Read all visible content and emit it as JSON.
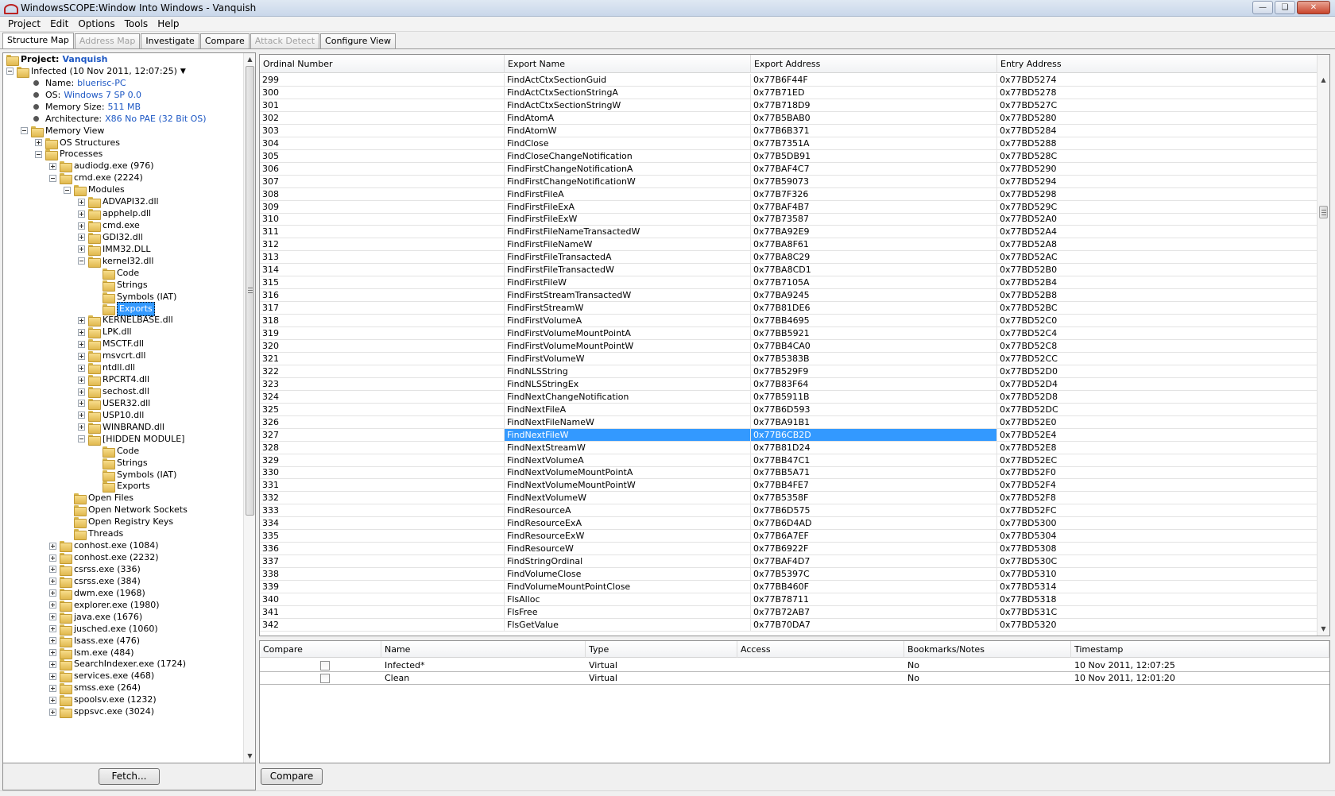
{
  "window": {
    "title": "WindowsSCOPE:Window Into Windows - Vanquish"
  },
  "menu": [
    "Project",
    "Edit",
    "Options",
    "Tools",
    "Help"
  ],
  "tabs": [
    {
      "label": "Structure Map",
      "state": "active"
    },
    {
      "label": "Address Map",
      "state": "disabled"
    },
    {
      "label": "Investigate",
      "state": "normal"
    },
    {
      "label": "Compare",
      "state": "normal"
    },
    {
      "label": "Attack Detect",
      "state": "disabled"
    },
    {
      "label": "Configure View",
      "state": "normal"
    }
  ],
  "tree": [
    {
      "label": "Project:",
      "value": "Vanquish",
      "level": 0,
      "kind": "folder",
      "bold": true
    },
    {
      "label": "Infected (10 Nov 2011, 12:07:25)",
      "level": 0,
      "kind": "folder",
      "exp": "minus",
      "dropdown": true
    },
    {
      "label": "Name:",
      "value": "bluerisc-PC",
      "level": 1,
      "kind": "bullet"
    },
    {
      "label": "OS:",
      "value": "Windows 7 SP 0.0",
      "level": 1,
      "kind": "bullet"
    },
    {
      "label": "Memory Size:",
      "value": "511 MB",
      "level": 1,
      "kind": "bullet"
    },
    {
      "label": "Architecture:",
      "value": "X86 No PAE (32 Bit OS)",
      "level": 1,
      "kind": "bullet"
    },
    {
      "label": "Memory View",
      "level": 1,
      "kind": "folder",
      "exp": "minus"
    },
    {
      "label": "OS Structures",
      "level": 2,
      "kind": "folder",
      "exp": "plus"
    },
    {
      "label": "Processes",
      "level": 2,
      "kind": "folder",
      "exp": "minus"
    },
    {
      "label": "audiodg.exe (976)",
      "level": 3,
      "kind": "folder",
      "exp": "plus"
    },
    {
      "label": "cmd.exe (2224)",
      "level": 3,
      "kind": "folder",
      "exp": "minus"
    },
    {
      "label": "Modules",
      "level": 4,
      "kind": "folder",
      "exp": "minus"
    },
    {
      "label": "ADVAPI32.dll",
      "level": 5,
      "kind": "folder",
      "exp": "plus"
    },
    {
      "label": "apphelp.dll",
      "level": 5,
      "kind": "folder",
      "exp": "plus"
    },
    {
      "label": "cmd.exe",
      "level": 5,
      "kind": "folder",
      "exp": "plus"
    },
    {
      "label": "GDI32.dll",
      "level": 5,
      "kind": "folder",
      "exp": "plus"
    },
    {
      "label": "IMM32.DLL",
      "level": 5,
      "kind": "folder",
      "exp": "plus"
    },
    {
      "label": "kernel32.dll",
      "level": 5,
      "kind": "folder",
      "exp": "minus"
    },
    {
      "label": "Code",
      "level": 6,
      "kind": "folder"
    },
    {
      "label": "Strings",
      "level": 6,
      "kind": "folder"
    },
    {
      "label": "Symbols (IAT)",
      "level": 6,
      "kind": "folder"
    },
    {
      "label": "Exports",
      "level": 6,
      "kind": "folder",
      "selected": true
    },
    {
      "label": "KERNELBASE.dll",
      "level": 5,
      "kind": "folder",
      "exp": "plus"
    },
    {
      "label": "LPK.dll",
      "level": 5,
      "kind": "folder",
      "exp": "plus"
    },
    {
      "label": "MSCTF.dll",
      "level": 5,
      "kind": "folder",
      "exp": "plus"
    },
    {
      "label": "msvcrt.dll",
      "level": 5,
      "kind": "folder",
      "exp": "plus"
    },
    {
      "label": "ntdll.dll",
      "level": 5,
      "kind": "folder",
      "exp": "plus"
    },
    {
      "label": "RPCRT4.dll",
      "level": 5,
      "kind": "folder",
      "exp": "plus"
    },
    {
      "label": "sechost.dll",
      "level": 5,
      "kind": "folder",
      "exp": "plus"
    },
    {
      "label": "USER32.dll",
      "level": 5,
      "kind": "folder",
      "exp": "plus"
    },
    {
      "label": "USP10.dll",
      "level": 5,
      "kind": "folder",
      "exp": "plus"
    },
    {
      "label": "WINBRAND.dll",
      "level": 5,
      "kind": "folder",
      "exp": "plus"
    },
    {
      "label": "[HIDDEN MODULE]",
      "level": 5,
      "kind": "folder",
      "exp": "minus"
    },
    {
      "label": "Code",
      "level": 6,
      "kind": "folder"
    },
    {
      "label": "Strings",
      "level": 6,
      "kind": "folder"
    },
    {
      "label": "Symbols (IAT)",
      "level": 6,
      "kind": "folder"
    },
    {
      "label": "Exports",
      "level": 6,
      "kind": "folder"
    },
    {
      "label": "Open Files",
      "level": 4,
      "kind": "folder"
    },
    {
      "label": "Open Network Sockets",
      "level": 4,
      "kind": "folder"
    },
    {
      "label": "Open Registry Keys",
      "level": 4,
      "kind": "folder"
    },
    {
      "label": "Threads",
      "level": 4,
      "kind": "folder"
    },
    {
      "label": "conhost.exe (1084)",
      "level": 3,
      "kind": "folder",
      "exp": "plus"
    },
    {
      "label": "conhost.exe (2232)",
      "level": 3,
      "kind": "folder",
      "exp": "plus"
    },
    {
      "label": "csrss.exe (336)",
      "level": 3,
      "kind": "folder",
      "exp": "plus"
    },
    {
      "label": "csrss.exe (384)",
      "level": 3,
      "kind": "folder",
      "exp": "plus"
    },
    {
      "label": "dwm.exe (1968)",
      "level": 3,
      "kind": "folder",
      "exp": "plus"
    },
    {
      "label": "explorer.exe (1980)",
      "level": 3,
      "kind": "folder",
      "exp": "plus"
    },
    {
      "label": "java.exe (1676)",
      "level": 3,
      "kind": "folder",
      "exp": "plus"
    },
    {
      "label": "jusched.exe (1060)",
      "level": 3,
      "kind": "folder",
      "exp": "plus"
    },
    {
      "label": "lsass.exe (476)",
      "level": 3,
      "kind": "folder",
      "exp": "plus"
    },
    {
      "label": "lsm.exe (484)",
      "level": 3,
      "kind": "folder",
      "exp": "plus"
    },
    {
      "label": "SearchIndexer.exe (1724)",
      "level": 3,
      "kind": "folder",
      "exp": "plus"
    },
    {
      "label": "services.exe (468)",
      "level": 3,
      "kind": "folder",
      "exp": "plus"
    },
    {
      "label": "smss.exe (264)",
      "level": 3,
      "kind": "folder",
      "exp": "plus"
    },
    {
      "label": "spoolsv.exe (1232)",
      "level": 3,
      "kind": "folder",
      "exp": "plus"
    },
    {
      "label": "sppsvc.exe (3024)",
      "level": 3,
      "kind": "folder",
      "exp": "plus"
    }
  ],
  "left_footer": {
    "fetch_label": "Fetch..."
  },
  "exports": {
    "columns": [
      "Ordinal Number",
      "Export Name",
      "Export Address",
      "Entry Address"
    ],
    "selected_ordinal": "327",
    "rows": [
      [
        "299",
        "FindActCtxSectionGuid",
        "0x77B6F44F",
        "0x77BD5274"
      ],
      [
        "300",
        "FindActCtxSectionStringA",
        "0x77B71ED",
        "0x77BD5278"
      ],
      [
        "301",
        "FindActCtxSectionStringW",
        "0x77B718D9",
        "0x77BD527C"
      ],
      [
        "302",
        "FindAtomA",
        "0x77B5BAB0",
        "0x77BD5280"
      ],
      [
        "303",
        "FindAtomW",
        "0x77B6B371",
        "0x77BD5284"
      ],
      [
        "304",
        "FindClose",
        "0x77B7351A",
        "0x77BD5288"
      ],
      [
        "305",
        "FindCloseChangeNotification",
        "0x77B5DB91",
        "0x77BD528C"
      ],
      [
        "306",
        "FindFirstChangeNotificationA",
        "0x77BAF4C7",
        "0x77BD5290"
      ],
      [
        "307",
        "FindFirstChangeNotificationW",
        "0x77B59073",
        "0x77BD5294"
      ],
      [
        "308",
        "FindFirstFileA",
        "0x77B7F326",
        "0x77BD5298"
      ],
      [
        "309",
        "FindFirstFileExA",
        "0x77BAF4B7",
        "0x77BD529C"
      ],
      [
        "310",
        "FindFirstFileExW",
        "0x77B73587",
        "0x77BD52A0"
      ],
      [
        "311",
        "FindFirstFileNameTransactedW",
        "0x77BA92E9",
        "0x77BD52A4"
      ],
      [
        "312",
        "FindFirstFileNameW",
        "0x77BA8F61",
        "0x77BD52A8"
      ],
      [
        "313",
        "FindFirstFileTransactedA",
        "0x77BA8C29",
        "0x77BD52AC"
      ],
      [
        "314",
        "FindFirstFileTransactedW",
        "0x77BA8CD1",
        "0x77BD52B0"
      ],
      [
        "315",
        "FindFirstFileW",
        "0x77B7105A",
        "0x77BD52B4"
      ],
      [
        "316",
        "FindFirstStreamTransactedW",
        "0x77BA9245",
        "0x77BD52B8"
      ],
      [
        "317",
        "FindFirstStreamW",
        "0x77B81DE6",
        "0x77BD52BC"
      ],
      [
        "318",
        "FindFirstVolumeA",
        "0x77BB4695",
        "0x77BD52C0"
      ],
      [
        "319",
        "FindFirstVolumeMountPointA",
        "0x77BB5921",
        "0x77BD52C4"
      ],
      [
        "320",
        "FindFirstVolumeMountPointW",
        "0x77BB4CA0",
        "0x77BD52C8"
      ],
      [
        "321",
        "FindFirstVolumeW",
        "0x77B5383B",
        "0x77BD52CC"
      ],
      [
        "322",
        "FindNLSString",
        "0x77B529F9",
        "0x77BD52D0"
      ],
      [
        "323",
        "FindNLSStringEx",
        "0x77B83F64",
        "0x77BD52D4"
      ],
      [
        "324",
        "FindNextChangeNotification",
        "0x77B5911B",
        "0x77BD52D8"
      ],
      [
        "325",
        "FindNextFileA",
        "0x77B6D593",
        "0x77BD52DC"
      ],
      [
        "326",
        "FindNextFileNameW",
        "0x77BA91B1",
        "0x77BD52E0"
      ],
      [
        "327",
        "FindNextFileW",
        "0x77B6CB2D",
        "0x77BD52E4"
      ],
      [
        "328",
        "FindNextStreamW",
        "0x77B81D24",
        "0x77BD52E8"
      ],
      [
        "329",
        "FindNextVolumeA",
        "0x77BB47C1",
        "0x77BD52EC"
      ],
      [
        "330",
        "FindNextVolumeMountPointA",
        "0x77BB5A71",
        "0x77BD52F0"
      ],
      [
        "331",
        "FindNextVolumeMountPointW",
        "0x77BB4FE7",
        "0x77BD52F4"
      ],
      [
        "332",
        "FindNextVolumeW",
        "0x77B5358F",
        "0x77BD52F8"
      ],
      [
        "333",
        "FindResourceA",
        "0x77B6D575",
        "0x77BD52FC"
      ],
      [
        "334",
        "FindResourceExA",
        "0x77B6D4AD",
        "0x77BD5300"
      ],
      [
        "335",
        "FindResourceExW",
        "0x77B6A7EF",
        "0x77BD5304"
      ],
      [
        "336",
        "FindResourceW",
        "0x77B6922F",
        "0x77BD5308"
      ],
      [
        "337",
        "FindStringOrdinal",
        "0x77BAF4D7",
        "0x77BD530C"
      ],
      [
        "338",
        "FindVolumeClose",
        "0x77B5397C",
        "0x77BD5310"
      ],
      [
        "339",
        "FindVolumeMountPointClose",
        "0x77BB460F",
        "0x77BD5314"
      ],
      [
        "340",
        "FlsAlloc",
        "0x77B78711",
        "0x77BD5318"
      ],
      [
        "341",
        "FlsFree",
        "0x77B72AB7",
        "0x77BD531C"
      ],
      [
        "342",
        "FlsGetValue",
        "0x77B70DA7",
        "0x77BD5320"
      ]
    ]
  },
  "compare": {
    "columns": [
      "Compare",
      "Name",
      "Type",
      "Access",
      "Bookmarks/Notes",
      "Timestamp"
    ],
    "rows": [
      {
        "checked": false,
        "name": "Infected*",
        "type": "Virtual",
        "access": "",
        "bookmarks": "No",
        "timestamp": "10 Nov 2011, 12:07:25"
      },
      {
        "checked": false,
        "name": "Clean",
        "type": "Virtual",
        "access": "",
        "bookmarks": "No",
        "timestamp": "10 Nov 2011, 12:01:20"
      }
    ],
    "button_label": "Compare"
  },
  "icons": {
    "app": "app-icon",
    "folder": "folder-icon",
    "expand": "expand-icon",
    "collapse": "collapse-icon",
    "bullet": "bullet-icon"
  }
}
